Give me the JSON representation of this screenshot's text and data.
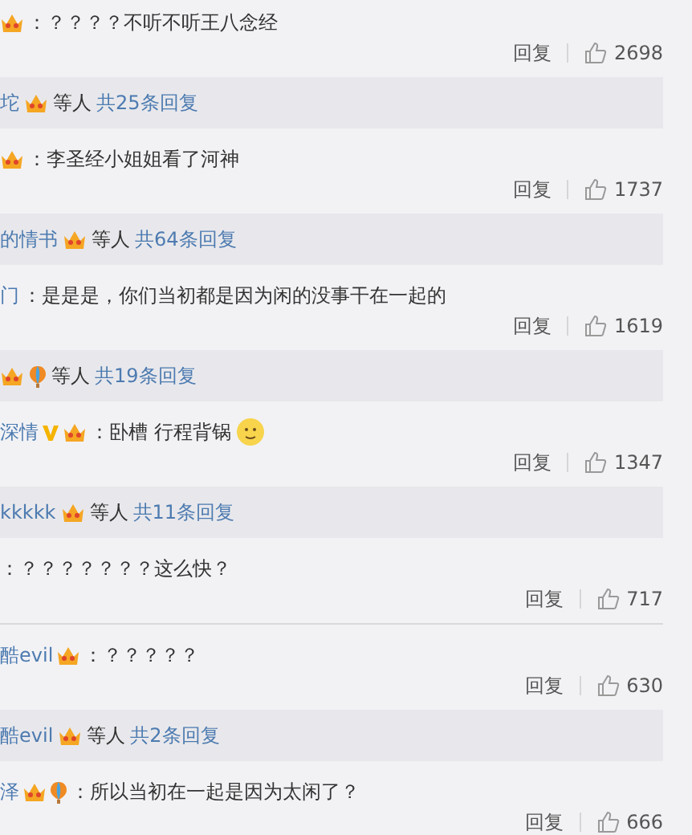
{
  "items": [
    {
      "kind": "comment",
      "badges": [
        {
          "kind": "member"
        }
      ],
      "text": "：？？？？不听不听王八念经",
      "reply": "回复",
      "likes": "2698"
    },
    {
      "kind": "summary",
      "author": "坨",
      "badges": [
        {
          "kind": "member"
        }
      ],
      "others": "等人",
      "count": "共25条回复"
    },
    {
      "kind": "comment",
      "badges": [
        {
          "kind": "member"
        }
      ],
      "text": "：李圣经小姐姐看了河神",
      "reply": "回复",
      "likes": "1737"
    },
    {
      "kind": "summary",
      "author": "的情书",
      "badges": [
        {
          "kind": "member"
        }
      ],
      "others": "等人",
      "count": "共64条回复"
    },
    {
      "kind": "comment",
      "author": "门",
      "text": "：是是是，你们当初都是因为闲的没事干在一起的",
      "reply": "回复",
      "likes": "1619"
    },
    {
      "kind": "summary",
      "badges": [
        {
          "kind": "member"
        },
        {
          "kind": "balloon"
        }
      ],
      "others": "等人",
      "count": "共19条回复"
    },
    {
      "kind": "comment",
      "author": "深情",
      "badges": [
        {
          "kind": "verified"
        },
        {
          "kind": "member"
        }
      ],
      "text": "：卧槽 行程背锅",
      "emoji": true,
      "reply": "回复",
      "likes": "1347"
    },
    {
      "kind": "summary",
      "author": "kkkkk",
      "badges": [
        {
          "kind": "member"
        }
      ],
      "others": "等人",
      "count": "共11条回复"
    },
    {
      "kind": "comment",
      "text": "：？？？？？？？这么快？",
      "reply": "回复",
      "likes": "717"
    },
    {
      "kind": "comment",
      "author": "酷evil",
      "badges": [
        {
          "kind": "member"
        }
      ],
      "text": "：？？？？？",
      "reply": "回复",
      "likes": "630"
    },
    {
      "kind": "summary",
      "author": "酷evil",
      "badges": [
        {
          "kind": "member"
        }
      ],
      "others": "等人",
      "count": "共2条回复"
    },
    {
      "kind": "comment",
      "author": "泽",
      "badges": [
        {
          "kind": "member"
        },
        {
          "kind": "balloon"
        }
      ],
      "text": "：所以当初在一起是因为太闲了？",
      "reply": "回复",
      "likes": "666"
    }
  ]
}
